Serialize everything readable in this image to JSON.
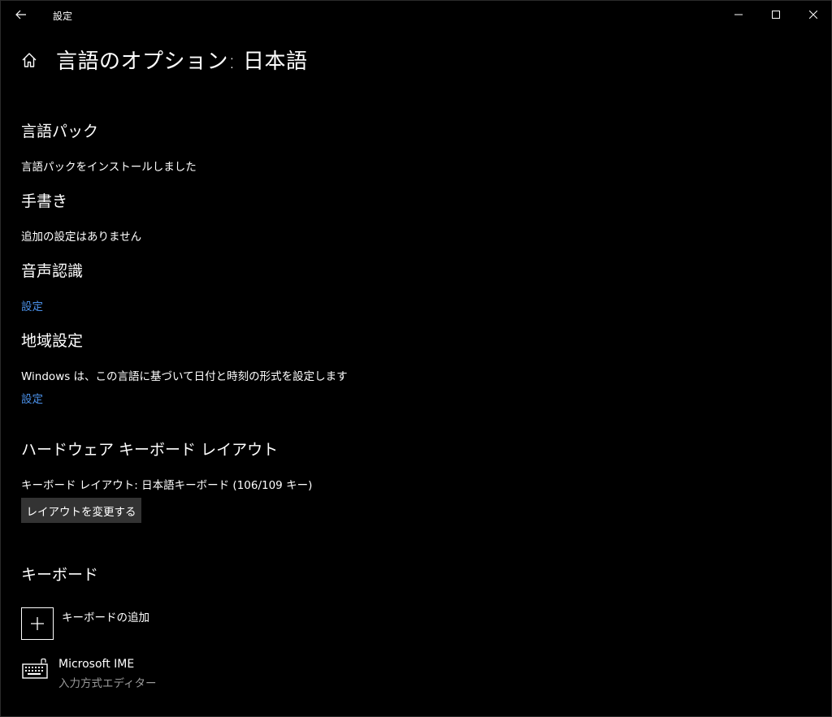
{
  "window": {
    "app_title": "設定"
  },
  "page": {
    "title": "言語のオプション: 日本語"
  },
  "sections": {
    "language_pack": {
      "heading": "言語パック",
      "status": "言語パックをインストールしました"
    },
    "handwriting": {
      "heading": "手書き",
      "status": "追加の設定はありません"
    },
    "speech": {
      "heading": "音声認識",
      "link": "設定"
    },
    "region": {
      "heading": "地域設定",
      "description": "Windows は、この言語に基づいて日付と時刻の形式を設定します",
      "link": "設定"
    },
    "hardware_keyboard": {
      "heading": "ハードウェア キーボード レイアウト",
      "current_layout": "キーボード レイアウト: 日本語キーボード (106/109 キー)",
      "change_button": "レイアウトを変更する"
    },
    "keyboard": {
      "heading": "キーボード",
      "add_label": "キーボードの追加",
      "items": [
        {
          "name": "Microsoft IME",
          "description": "入力方式エディター"
        }
      ]
    }
  },
  "icons": {
    "back": "back-arrow-icon",
    "home": "home-icon",
    "minimize": "minimize-icon",
    "maximize": "maximize-icon",
    "close": "close-icon",
    "add": "plus-icon",
    "keyboard": "keyboard-icon"
  },
  "colors": {
    "background": "#000000",
    "text": "#ffffff",
    "link": "#4a8fe7",
    "button_bg": "#333333",
    "secondary_text": "#9a9a9a"
  }
}
